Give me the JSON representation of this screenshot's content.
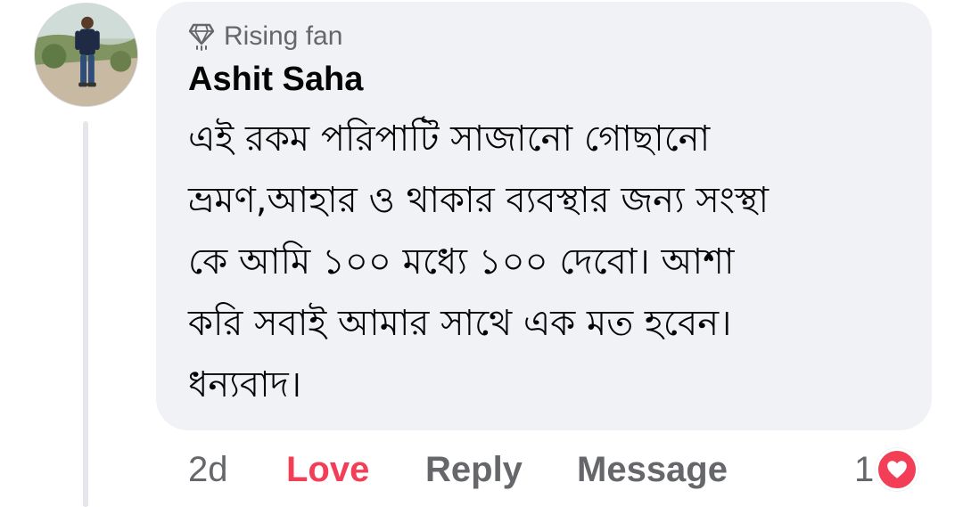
{
  "comment": {
    "badge": "Rising fan",
    "badge_icon": "diamond-fan-icon",
    "author": "Ashit Saha",
    "lines": [
      "এই রকম পরিপাটি সাজানো গোছানো",
      "ভ্রমণ,আহার ও থাকার ব্যবস্থার জন্য সংস্থা",
      "কে আমি ১০০ মধ্যে ১০০ দেবো। আশা",
      "করি সবাই আমার সাথে এক মত হবেন।",
      "ধন্যবাদ।"
    ]
  },
  "actions": {
    "time": "2d",
    "love_label": "Love",
    "reply_label": "Reply",
    "message_label": "Message"
  },
  "reactions": {
    "count": "1",
    "icon": "heart-icon",
    "color": "#f33e58"
  },
  "colors": {
    "bubble": "#f0f2f5",
    "secondary_text": "#65676b",
    "love": "#f33e58"
  }
}
